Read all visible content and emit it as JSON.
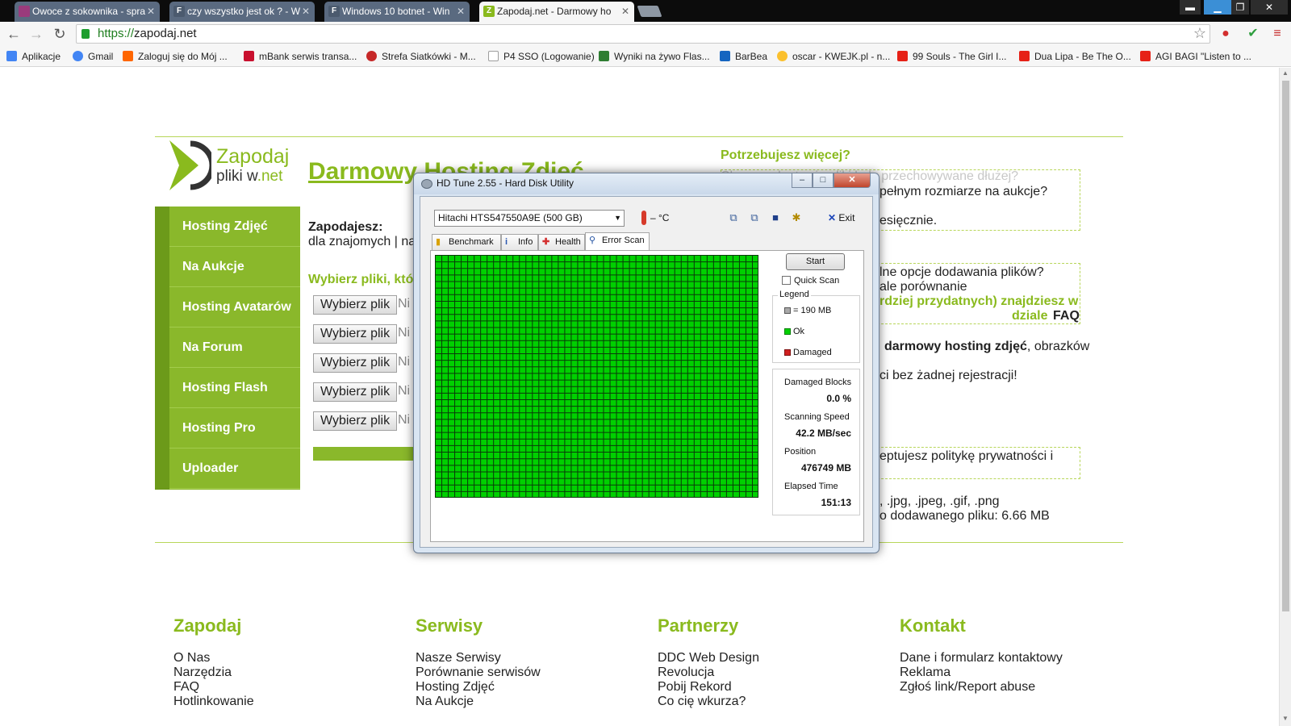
{
  "browser": {
    "tabs": [
      {
        "title": "Owoce z sokownika - spra",
        "fav": "Ow",
        "fav_color": "#9a3b7c"
      },
      {
        "title": "czy wszystko jest ok ? - W",
        "fav": "F",
        "fav_color": "#4b5a6e"
      },
      {
        "title": "Windows 10 botnet - Win",
        "fav": "F",
        "fav_color": "#4b5a6e"
      },
      {
        "title": "Zapodaj.net - Darmowy ho",
        "fav": "Z",
        "fav_color": "#8aba1e"
      }
    ],
    "url_scheme": "https://",
    "url_host": "zapodaj.net",
    "bookmarks": [
      {
        "label": "Aplikacje",
        "color": "#4285f4"
      },
      {
        "label": "Gmail",
        "color": "#4285f4"
      },
      {
        "label": "Zaloguj się do Mój ...",
        "color": "#ff6600"
      },
      {
        "label": "mBank serwis transa...",
        "color": "#c8102e"
      },
      {
        "label": "Strefa Siatkówki - M...",
        "color": "#c62828"
      },
      {
        "label": "P4 SSO (Logowanie)",
        "color": "#9e9e9e"
      },
      {
        "label": "Wyniki na żywo Flas...",
        "color": "#2e7d32"
      },
      {
        "label": "BarBea",
        "color": "#1565c0"
      },
      {
        "label": "oscar - KWEJK.pl - n...",
        "color": "#fbc02d"
      },
      {
        "label": "99 Souls - The Girl I...",
        "color": "#e62117"
      },
      {
        "label": "Dua Lipa - Be The O...",
        "color": "#e62117"
      },
      {
        "label": "AGI BAGI \"Listen to ...",
        "color": "#e62117"
      }
    ]
  },
  "site": {
    "logo_top": "Zapodaj",
    "logo_bottom_a": "pliki w",
    "logo_bottom_b": ".net",
    "nav": [
      "Hosting Zdjęć",
      "Na Aukcje",
      "Hosting Avatarów",
      "Na Forum",
      "Hosting Flash",
      "Hosting Pro",
      "Uploader"
    ],
    "heading": "Darmowy Hosting Zdjęć",
    "zapodajesz": "Zapodajesz:",
    "for_whom": "dla znajomych | na",
    "choose_files": "Wybierz pliki, któ",
    "file_btn": "Wybierz plik",
    "file_none": "Ni",
    "right_title": "Potrzebujesz więcej?",
    "r1a": "Chcesz, aby twoje pliki były przechowywane dłużej?",
    "r1b": "pełnym rozmiarze na aukcje?",
    "r1c": "esięcznie.",
    "r2a": "lne opcje dodawania plików?",
    "r2b": "ale porównanie",
    "r2c": "rdziej przydatnych) znajdziesz w",
    "r2d": "dziale",
    "faq": "FAQ",
    "desc_bold": "darmowy hosting zdjęć",
    "desc_rest": ", obrazków",
    "desc2": "ci bez żadnej rejestracji!",
    "privacy": "eptujesz politykę prywatności i",
    "formats": ", .jpg, .jpeg, .gif, .png",
    "maxsize": "o dodawanego pliku: 6.66 MB"
  },
  "footer": [
    {
      "title": "Zapodaj",
      "links": [
        "O Nas",
        "Narzędzia",
        "FAQ",
        "Hotlinkowanie"
      ]
    },
    {
      "title": "Serwisy",
      "links": [
        "Nasze Serwisy",
        "Porównanie serwisów",
        "Hosting Zdjęć",
        "Na Aukcje"
      ]
    },
    {
      "title": "Partnerzy",
      "links": [
        "DDC Web Design",
        "Revolucja",
        "Pobij Rekord",
        "Co cię wkurza?"
      ]
    },
    {
      "title": "Kontakt",
      "links": [
        "Dane i formularz kontaktowy",
        "Reklama",
        "Zgłoś link/Report abuse"
      ]
    }
  ],
  "hdtune": {
    "title": "HD Tune 2.55 - Hard Disk Utility",
    "drive": "Hitachi HTS547550A9E (500 GB)",
    "temp": "– °C",
    "exit": "Exit",
    "tabs": [
      "Benchmark",
      "Info",
      "Health",
      "Error Scan"
    ],
    "start": "Start",
    "quick_scan": "Quick Scan",
    "legend_title": "Legend",
    "legend_block": "= 190 MB",
    "legend_ok": "Ok",
    "legend_damaged": "Damaged",
    "ok_color": "#00d000",
    "damaged_color": "#d02020",
    "damaged_blocks_label": "Damaged Blocks",
    "damaged_blocks": "0.0 %",
    "speed_label": "Scanning Speed",
    "speed": "42.2 MB/sec",
    "position_label": "Position",
    "position": "476749 MB",
    "elapsed_label": "Elapsed Time",
    "elapsed": "151:13"
  }
}
